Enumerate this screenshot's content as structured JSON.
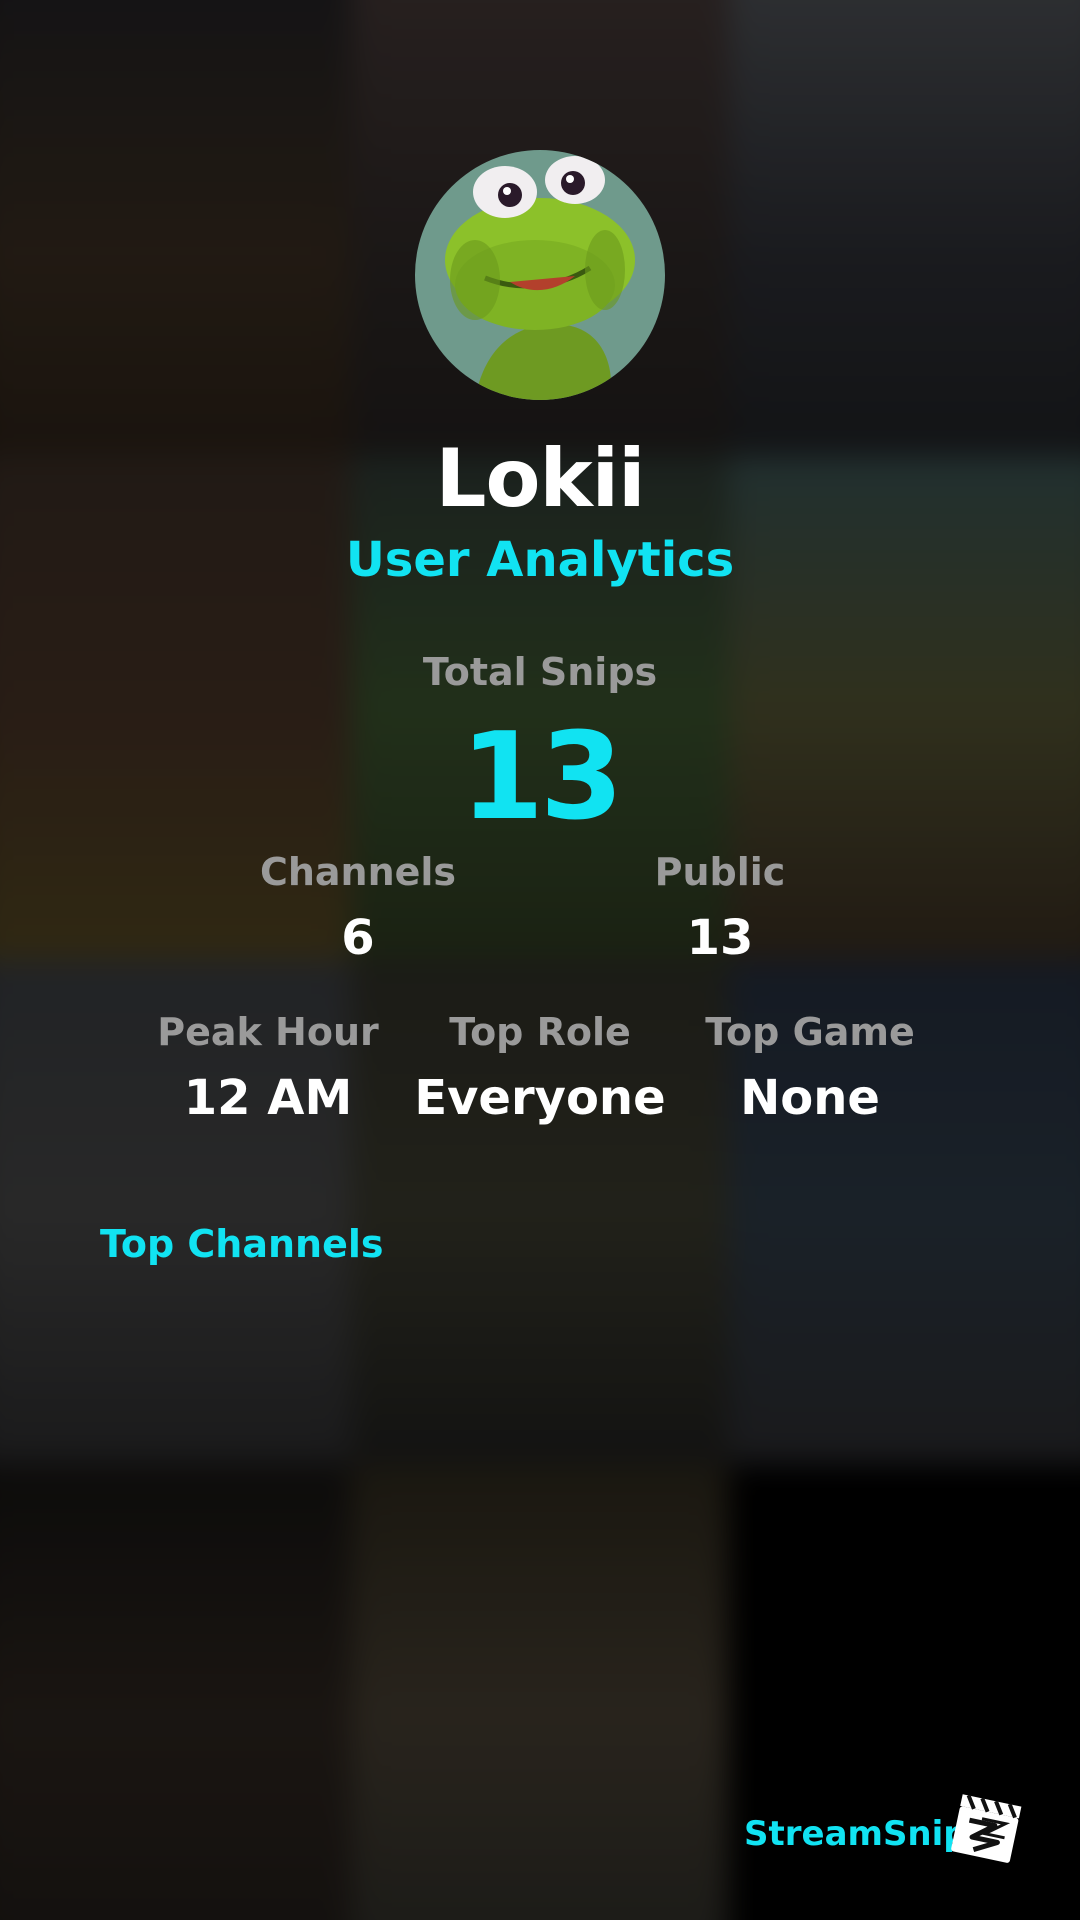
{
  "profile": {
    "username": "Lokii",
    "subtitle": "User Analytics",
    "avatar_icon": "frog-avatar-icon"
  },
  "stats": {
    "total_snips_label": "Total Snips",
    "total_snips_value": "13",
    "channels_label": "Channels",
    "channels_value": "6",
    "public_label": "Public",
    "public_value": "13",
    "peak_hour_label": "Peak Hour",
    "peak_hour_value": "12 AM",
    "top_role_label": "Top Role",
    "top_role_value": "Everyone",
    "top_game_label": "Top Game",
    "top_game_value": "None"
  },
  "sections": {
    "top_channels_label": "Top Channels"
  },
  "branding": {
    "name": "StreamSnip",
    "logo_icon": "clapperboard-icon"
  },
  "colors": {
    "accent": "#11e3f2",
    "label_gray": "#9a9a9a",
    "value_white": "#ffffff",
    "background": "#000000"
  }
}
